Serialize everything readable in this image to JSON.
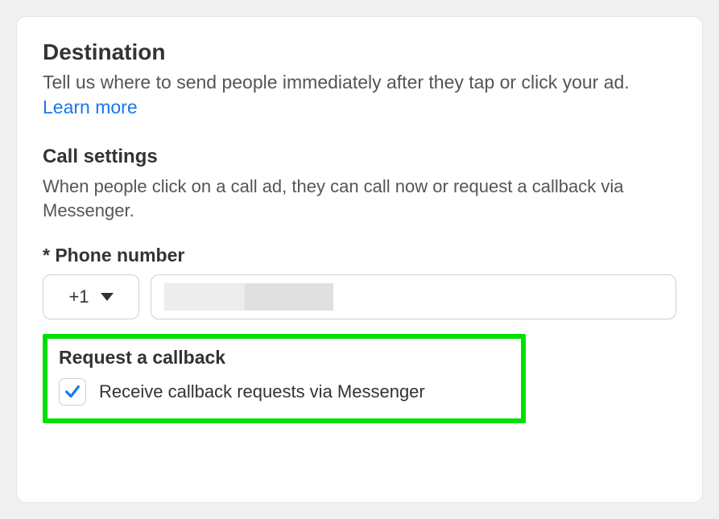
{
  "destination": {
    "title": "Destination",
    "description": "Tell us where to send people immediately after they tap or click your ad. ",
    "learn_more": "Learn more"
  },
  "call_settings": {
    "title": "Call settings",
    "description": "When people click on a call ad, they can call now or request a callback via Messenger."
  },
  "phone": {
    "label": "* Phone number",
    "country_code": "+1",
    "value": ""
  },
  "callback": {
    "title": "Request a callback",
    "checkbox_label": "Receive callback requests via Messenger",
    "checked": true
  }
}
